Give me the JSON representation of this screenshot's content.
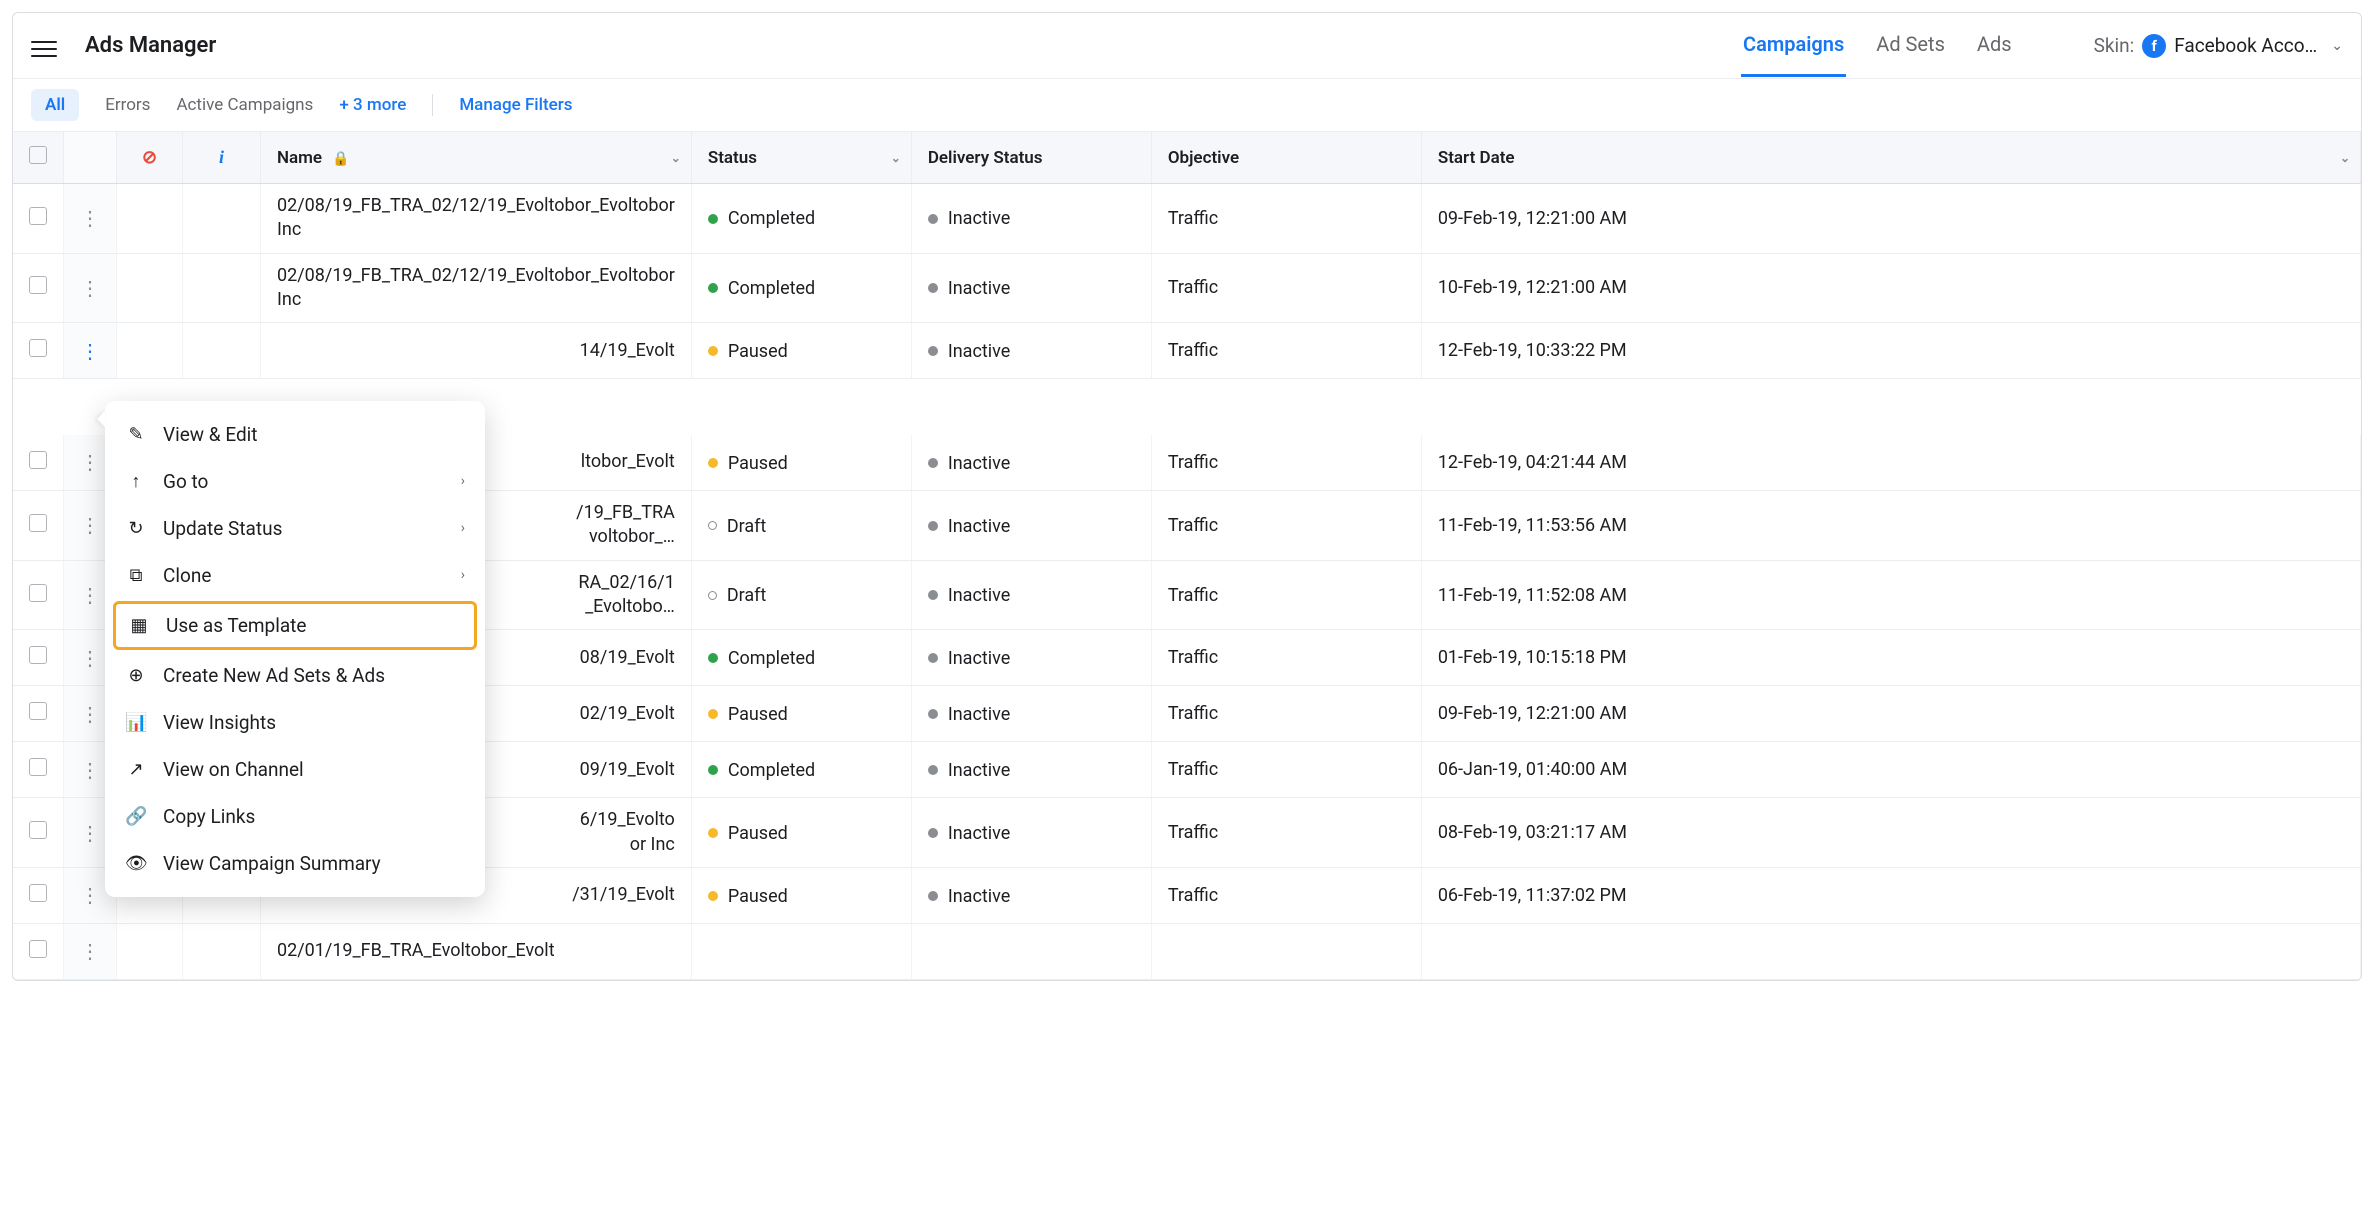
{
  "header": {
    "title": "Ads Manager",
    "tabs": [
      "Campaigns",
      "Ad Sets",
      "Ads"
    ],
    "active_tab": 0,
    "skin_label": "Skin:",
    "skin_value": "Facebook Acco…"
  },
  "filters": {
    "all": "All",
    "items": [
      "Errors",
      "Active Campaigns"
    ],
    "more": "+ 3 more",
    "manage": "Manage Filters"
  },
  "columns": {
    "name": "Name",
    "status": "Status",
    "delivery": "Delivery Status",
    "objective": "Objective",
    "start_date": "Start Date"
  },
  "status_labels": {
    "Completed": "Completed",
    "Paused": "Paused",
    "Draft": "Draft",
    "Inactive": "Inactive"
  },
  "rows": [
    {
      "name": "02/08/19_FB_TRA_02/12/19_Evoltobor_Evoltobor Inc",
      "status": "Completed",
      "delivery": "Inactive",
      "objective": "Traffic",
      "date": "09-Feb-19, 12:21:00 AM"
    },
    {
      "name": "02/08/19_FB_TRA_02/12/19_Evoltobor_Evoltobor Inc",
      "status": "Completed",
      "delivery": "Inactive",
      "objective": "Traffic",
      "date": "10-Feb-19, 12:21:00 AM"
    },
    {
      "name": "14/19_Evolt",
      "status": "Paused",
      "delivery": "Inactive",
      "objective": "Traffic",
      "date": "12-Feb-19, 10:33:22 PM"
    },
    {
      "name": "ltobor_Evolt",
      "status": "Paused",
      "delivery": "Inactive",
      "objective": "Traffic",
      "date": "12-Feb-19, 04:21:44 AM"
    },
    {
      "name": "/19_FB_TRA\nvoltobor_…",
      "status": "Draft",
      "delivery": "Inactive",
      "objective": "Traffic",
      "date": "11-Feb-19, 11:53:56 AM"
    },
    {
      "name": "RA_02/16/1\n_Evoltobo…",
      "status": "Draft",
      "delivery": "Inactive",
      "objective": "Traffic",
      "date": "11-Feb-19, 11:52:08 AM"
    },
    {
      "name": "08/19_Evolt",
      "status": "Completed",
      "delivery": "Inactive",
      "objective": "Traffic",
      "date": "01-Feb-19, 10:15:18 PM"
    },
    {
      "name": "02/19_Evolt",
      "status": "Paused",
      "delivery": "Inactive",
      "objective": "Traffic",
      "date": "09-Feb-19, 12:21:00 AM"
    },
    {
      "name": "09/19_Evolt",
      "status": "Completed",
      "delivery": "Inactive",
      "objective": "Traffic",
      "date": "06-Jan-19, 01:40:00 AM"
    },
    {
      "name": "6/19_Evolto\nor Inc",
      "status": "Paused",
      "delivery": "Inactive",
      "objective": "Traffic",
      "date": "08-Feb-19, 03:21:17 AM"
    },
    {
      "name": "/31/19_Evolt",
      "status": "Paused",
      "delivery": "Inactive",
      "objective": "Traffic",
      "date": "06-Feb-19, 11:37:02 PM"
    },
    {
      "name": "02/01/19_FB_TRA_Evoltobor_Evolt",
      "status": "",
      "delivery": "",
      "objective": "",
      "date": ""
    }
  ],
  "menu": {
    "view_edit": "View & Edit",
    "go_to": "Go to",
    "update_status": "Update Status",
    "clone": "Clone",
    "use_template": "Use as Template",
    "create_new": "Create New Ad Sets & Ads",
    "view_insights": "View Insights",
    "view_channel": "View on Channel",
    "copy_links": "Copy Links",
    "view_summary": "View Campaign Summary"
  },
  "active_row_index": 2
}
